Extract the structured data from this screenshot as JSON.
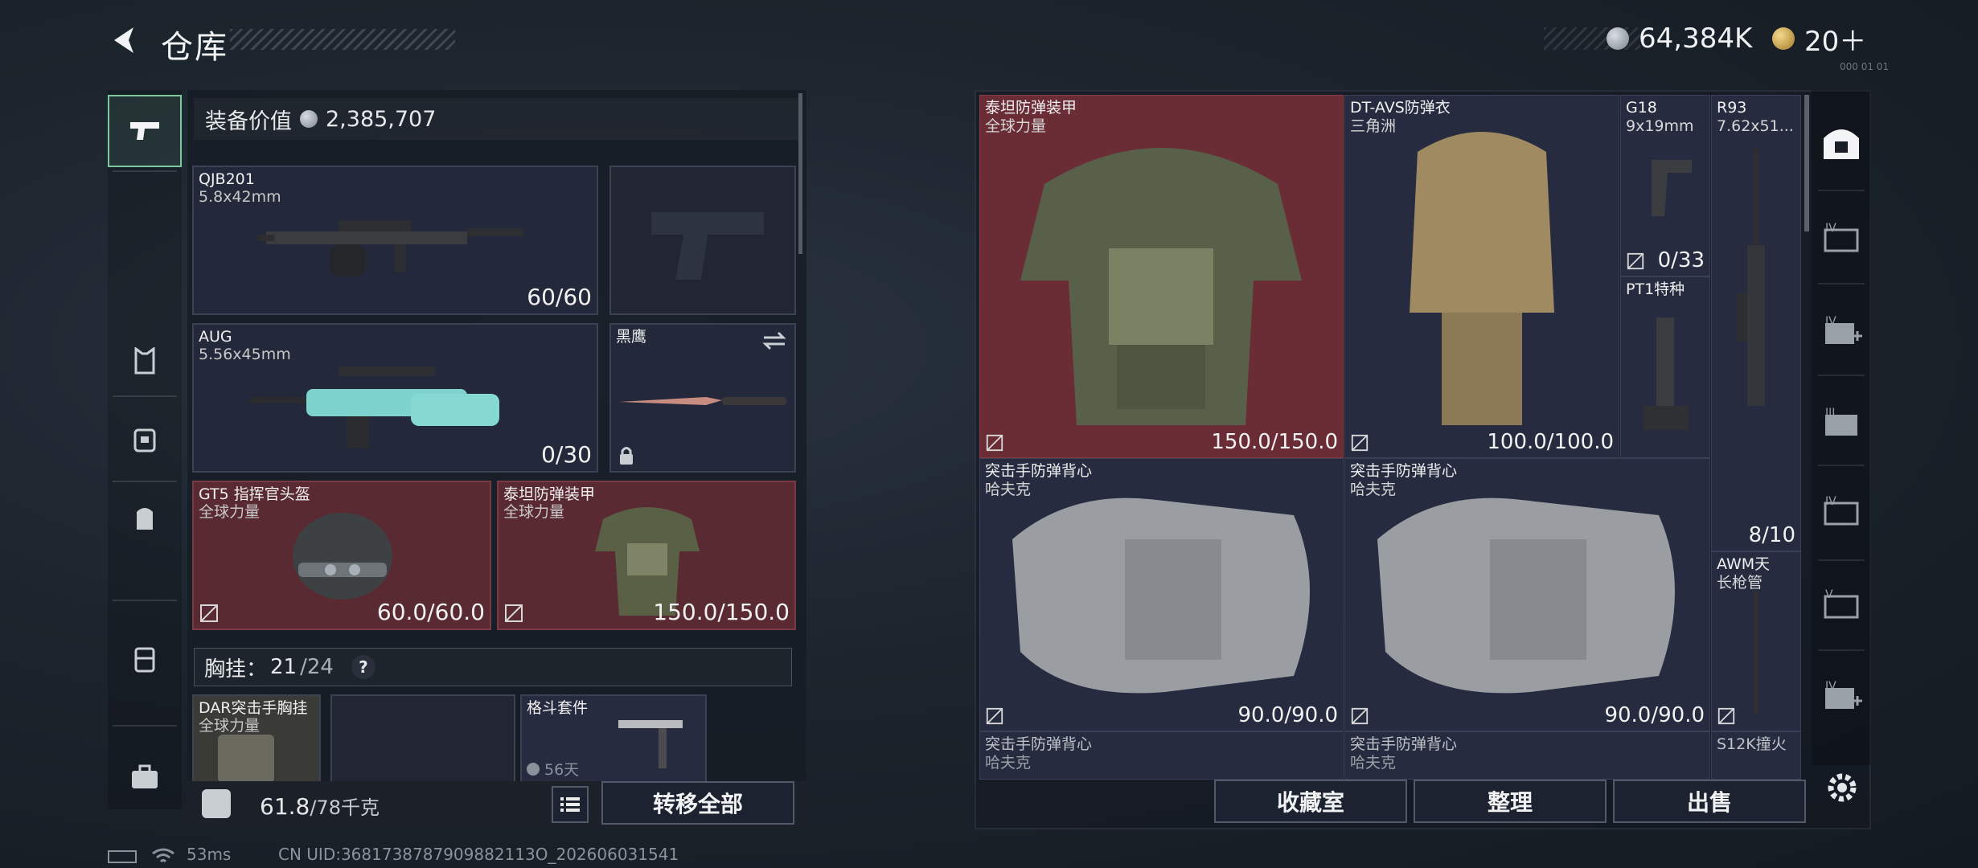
{
  "header": {
    "title": "仓库",
    "currency_main": "64,384K",
    "currency_secondary": "20＋",
    "tiny_label": "000 01 01"
  },
  "left_panel": {
    "equip_value_label": "装备价值",
    "equip_value": "2,385,707",
    "weapons": [
      {
        "name": "QJB201",
        "ammo": "5.8x42mm",
        "count": "60/60"
      },
      {
        "name": "AUG",
        "ammo": "5.56x45mm",
        "count": "0/30"
      }
    ],
    "knife": {
      "name": "黑鹰"
    },
    "armor": [
      {
        "name": "GT5 指挥官头盔",
        "sub": "全球力量",
        "durability": "60.0/60.0"
      },
      {
        "name": "泰坦防弹装甲",
        "sub": "全球力量",
        "durability": "150.0/150.0"
      }
    ],
    "chest_rig": {
      "label": "胸挂：",
      "used": "21",
      "total": "/24",
      "help": "?"
    },
    "rig_items": [
      {
        "name": "DAR突击手胸挂",
        "sub": "全球力量"
      },
      {
        "name": "格斗套件",
        "sub": "56天"
      }
    ],
    "weight": {
      "value": "61.8",
      "max": "/78千克"
    },
    "transfer_all": "转移全部"
  },
  "right_panel": {
    "items": [
      {
        "name": "泰坦防弹装甲",
        "sub": "全球力量",
        "durability": "150.0/150.0"
      },
      {
        "name": "DT-AVS防弹衣",
        "sub": "三角洲",
        "durability": "100.0/100.0"
      },
      {
        "name": "G18",
        "sub": "9x19mm",
        "count": "0/33"
      },
      {
        "name": "R93",
        "sub": "7.62x51...",
        "count": "8/10"
      },
      {
        "name": "PT1特种",
        "sub": ""
      },
      {
        "name": "突击手防弹背心",
        "sub": "哈夫克",
        "durability": "90.0/90.0"
      },
      {
        "name": "突击手防弹背心",
        "sub": "哈夫克",
        "durability": "90.0/90.0"
      },
      {
        "name": "AWM天",
        "sub": "长枪管"
      },
      {
        "name": "突击手防弹背心",
        "sub": "哈夫克"
      },
      {
        "name": "突击手防弹背心",
        "sub": "哈夫克"
      },
      {
        "name": "S12K撞火",
        "sub": ""
      }
    ],
    "buttons": {
      "collection": "收藏室",
      "sort": "整理",
      "sell": "出售"
    }
  },
  "status_bar": {
    "ping": "53ms",
    "uid": "CN UID:3681738787909882113O_202606031541"
  },
  "colors": {
    "accent_green": "#7ec8a0",
    "rare_red": "#6a2c35",
    "common_blue": "#262b40"
  }
}
